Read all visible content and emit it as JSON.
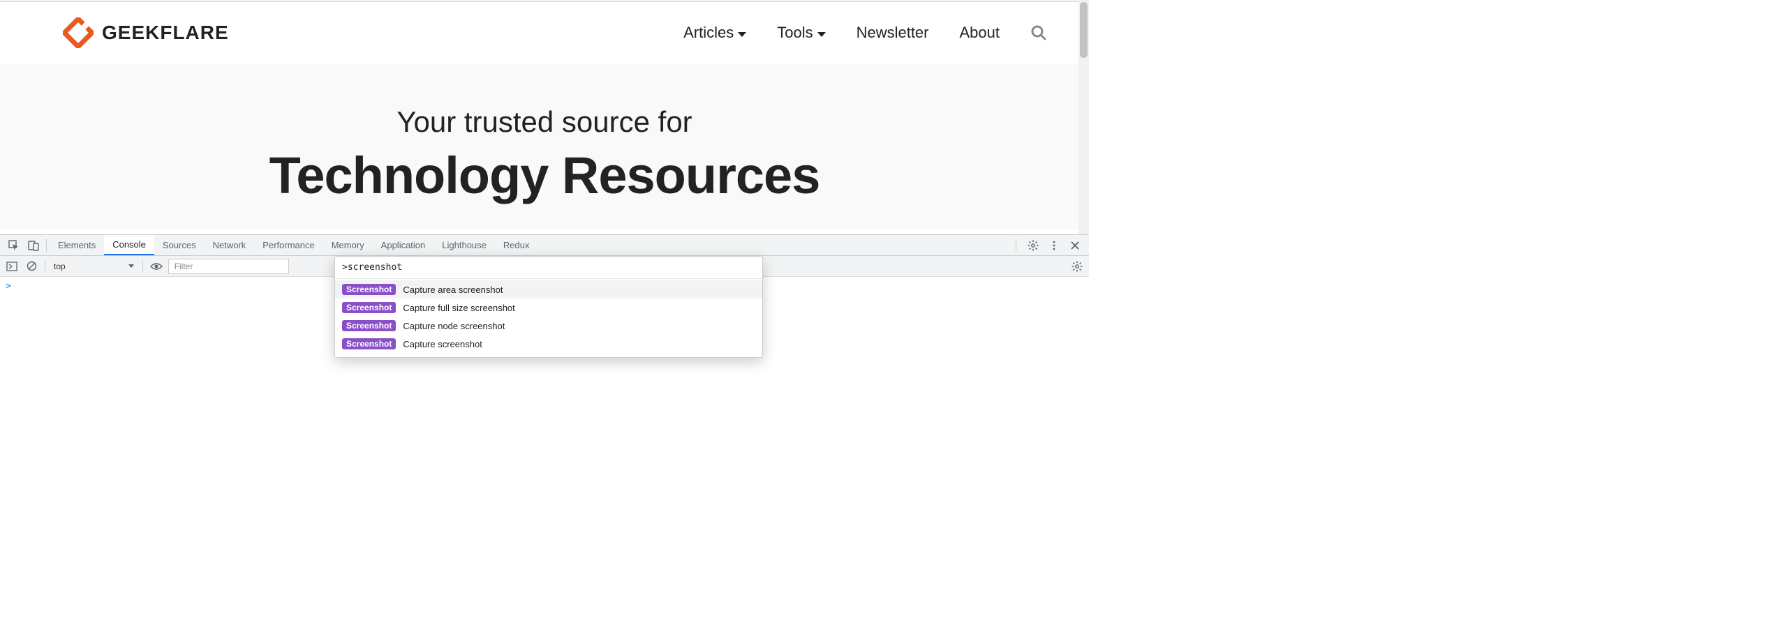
{
  "site": {
    "brand": "GEEKFLARE",
    "nav": {
      "articles": "Articles",
      "tools": "Tools",
      "newsletter": "Newsletter",
      "about": "About"
    },
    "hero_sub": "Your trusted source for",
    "hero_title": "Technology Resources"
  },
  "devtools": {
    "tabs": {
      "elements": "Elements",
      "console": "Console",
      "sources": "Sources",
      "network": "Network",
      "performance": "Performance",
      "memory": "Memory",
      "application": "Application",
      "lighthouse": "Lighthouse",
      "redux": "Redux"
    },
    "active_tab": "console",
    "console": {
      "context": "top",
      "filter_placeholder": "Filter",
      "prompt": ">"
    },
    "command_menu": {
      "query": ">screenshot",
      "badge": "Screenshot",
      "items": [
        "Capture area screenshot",
        "Capture full size screenshot",
        "Capture node screenshot",
        "Capture screenshot"
      ]
    }
  }
}
